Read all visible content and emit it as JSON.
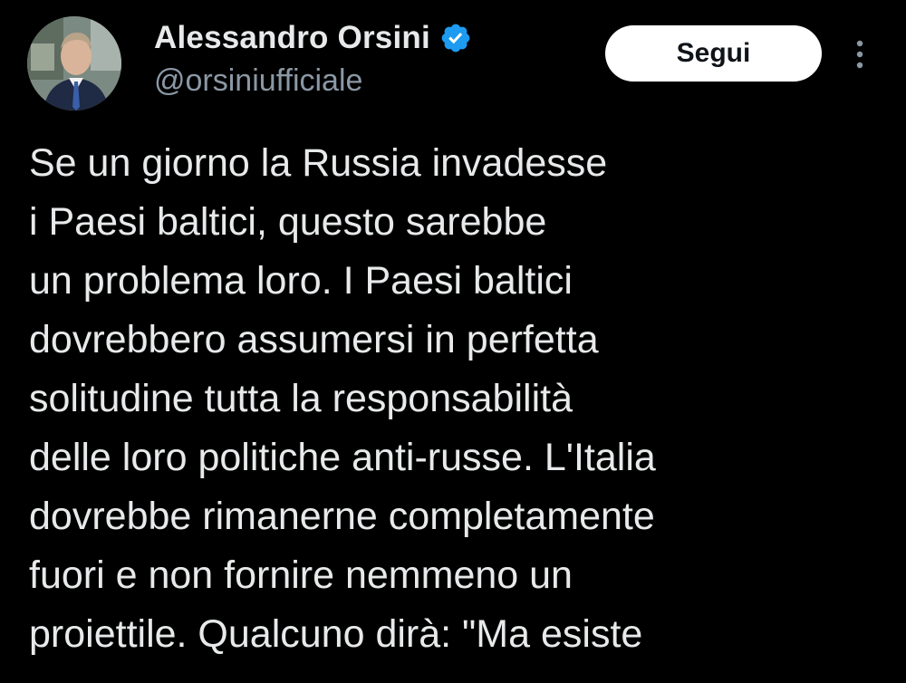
{
  "author": {
    "display_name": "Alessandro Orsini",
    "handle": "@orsiniufficiale",
    "verified_icon": "verified-badge-icon",
    "avatar_icon": "profile-photo"
  },
  "actions": {
    "follow_label": "Segui",
    "more_icon": "more-options-icon"
  },
  "tweet": {
    "lines": [
      "Se un giorno la Russia invadesse",
      "i Paesi baltici, questo sarebbe",
      "un problema loro. I Paesi baltici",
      "dovrebbero assumersi in perfetta",
      "solitudine tutta la responsabilità",
      "delle loro politiche anti-russe. L'Italia",
      "dovrebbe rimanerne completamente",
      "fuori e non fornire nemmeno un",
      "proiettile. Qualcuno dirà: \"Ma esiste"
    ]
  },
  "colors": {
    "background": "#000000",
    "text_primary": "#e7e9ea",
    "text_secondary": "#8b98a5",
    "verified_blue": "#1d9bf0",
    "follow_button_bg": "#ffffff",
    "follow_button_text": "#0f1419"
  }
}
